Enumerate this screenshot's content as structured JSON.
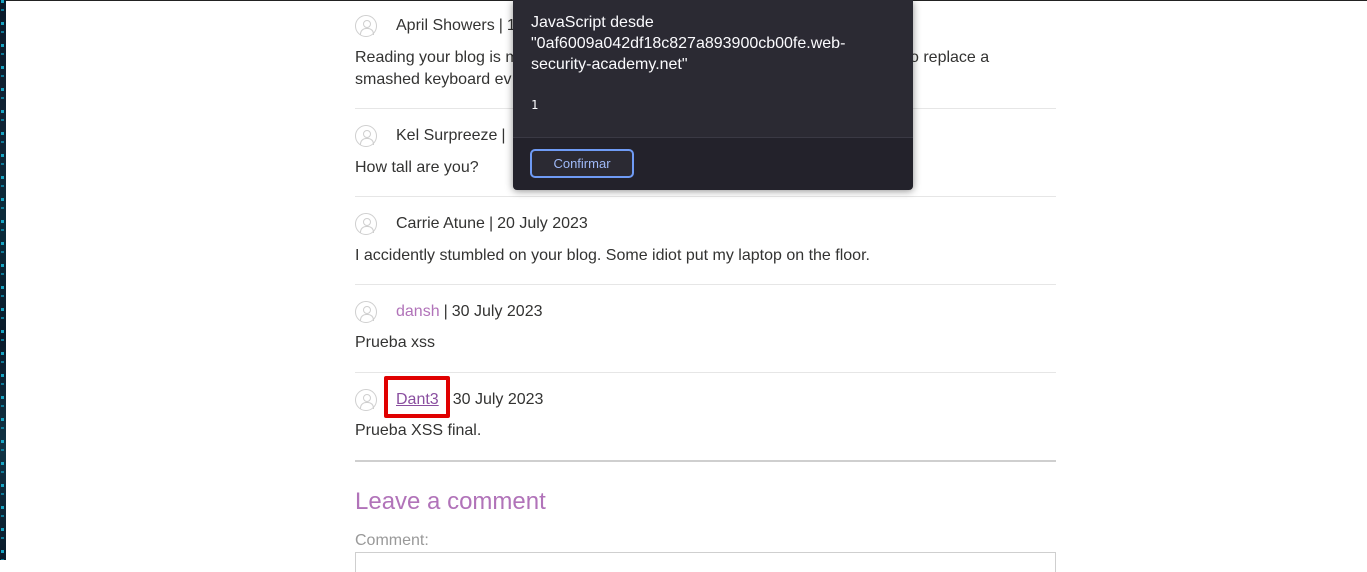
{
  "comments": [
    {
      "author": "April Showers",
      "separator": "|",
      "date": "1",
      "text": "Reading your blog is m",
      "text_tail": "o replace a",
      "text_line2": "smashed keyboard ev"
    },
    {
      "author": "Kel Surpreeze",
      "separator": "|",
      "text": "How tall are you?"
    },
    {
      "author": "Carrie Atune",
      "separator": "|",
      "date": "20 July 2023",
      "text": "I accidently stumbled on your blog. Some idiot put my laptop on the floor."
    },
    {
      "author": "dansh",
      "separator": "|",
      "date": "30 July 2023",
      "text": "Prueba xss"
    },
    {
      "author": "Dant3",
      "date": "30 July 2023",
      "text": "Prueba XSS final."
    }
  ],
  "leave_comment": {
    "title": "Leave a comment",
    "comment_label": "Comment:"
  },
  "dialog": {
    "title": "JavaScript desde \"0af6009a042df18c827a893900cb00fe.web-security-academy.net\"",
    "message": "1",
    "confirm_label": "Confirmar"
  },
  "colors": {
    "link": "#b173b9",
    "highlight": "#e00000",
    "dialog_bg": "#2b2a33",
    "button_border": "#6f9bf5"
  }
}
